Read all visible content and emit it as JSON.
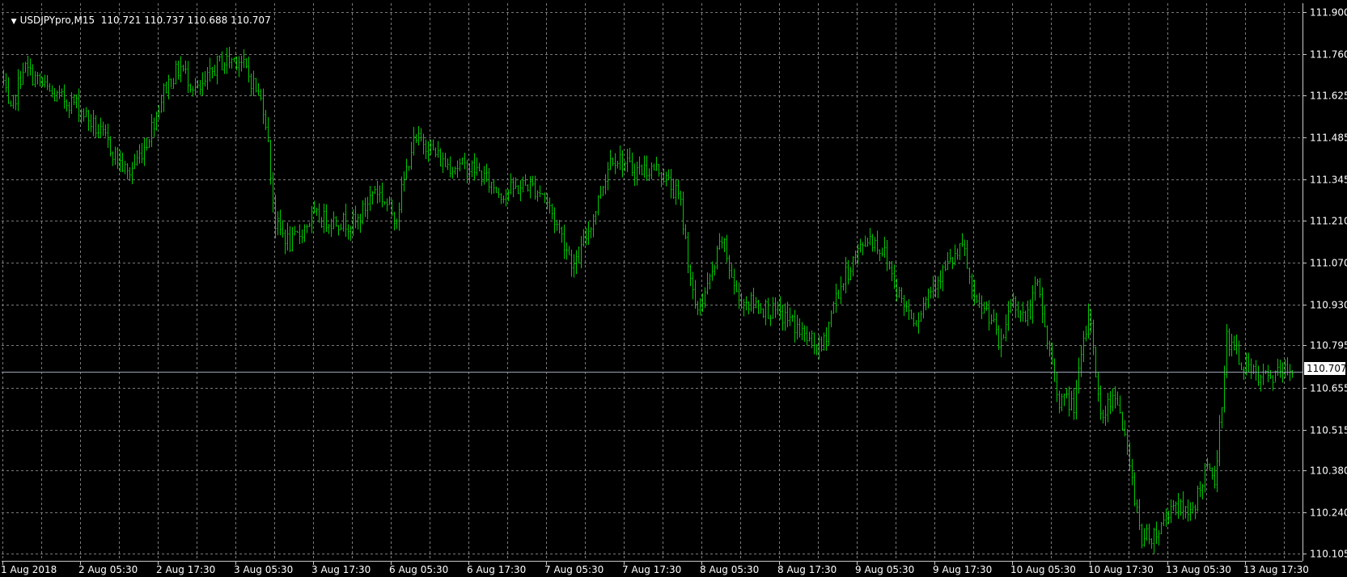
{
  "header": {
    "symbol": "USDJPYpro,M15",
    "ohlc": "110.721 110.737 110.688 110.707"
  },
  "current_price_label": "110.707",
  "chart_data": {
    "type": "bar",
    "title": "USDJPYpro,M15",
    "timeframe": "M15",
    "y_ticks": [
      "111.900",
      "111.760",
      "111.625",
      "111.485",
      "111.345",
      "111.210",
      "111.070",
      "110.930",
      "110.795",
      "110.655",
      "110.515",
      "110.380",
      "110.240",
      "110.105"
    ],
    "x_ticks": [
      "1 Aug 2018",
      "2 Aug 05:30",
      "2 Aug 17:30",
      "3 Aug 05:30",
      "3 Aug 17:30",
      "6 Aug 05:30",
      "6 Aug 17:30",
      "7 Aug 05:30",
      "7 Aug 17:30",
      "8 Aug 05:30",
      "8 Aug 17:30",
      "9 Aug 05:30",
      "9 Aug 17:30",
      "10 Aug 05:30",
      "10 Aug 17:30",
      "13 Aug 05:30",
      "13 Aug 17:30"
    ],
    "ylim": [
      110.08,
      111.93
    ],
    "current_price": 110.707,
    "grid": true,
    "series_color": "#00c800",
    "price_path": [
      {
        "t": 0,
        "p": 111.7
      },
      {
        "t": 3,
        "p": 111.55
      },
      {
        "t": 8,
        "p": 111.72
      },
      {
        "t": 20,
        "p": 111.62
      },
      {
        "t": 28,
        "p": 111.6
      },
      {
        "t": 40,
        "p": 111.47
      },
      {
        "t": 48,
        "p": 111.36
      },
      {
        "t": 55,
        "p": 111.47
      },
      {
        "t": 62,
        "p": 111.65
      },
      {
        "t": 68,
        "p": 111.72
      },
      {
        "t": 75,
        "p": 111.63
      },
      {
        "t": 82,
        "p": 111.73
      },
      {
        "t": 90,
        "p": 111.75
      },
      {
        "t": 96,
        "p": 111.66
      },
      {
        "t": 100,
        "p": 111.58
      },
      {
        "t": 104,
        "p": 111.2
      },
      {
        "t": 110,
        "p": 111.13
      },
      {
        "t": 118,
        "p": 111.22
      },
      {
        "t": 135,
        "p": 111.2
      },
      {
        "t": 142,
        "p": 111.32
      },
      {
        "t": 150,
        "p": 111.22
      },
      {
        "t": 156,
        "p": 111.46
      },
      {
        "t": 160,
        "p": 111.48
      },
      {
        "t": 168,
        "p": 111.4
      },
      {
        "t": 180,
        "p": 111.38
      },
      {
        "t": 190,
        "p": 111.3
      },
      {
        "t": 200,
        "p": 111.33
      },
      {
        "t": 206,
        "p": 111.3
      },
      {
        "t": 213,
        "p": 111.16
      },
      {
        "t": 218,
        "p": 111.05
      },
      {
        "t": 226,
        "p": 111.25
      },
      {
        "t": 232,
        "p": 111.43
      },
      {
        "t": 240,
        "p": 111.38
      },
      {
        "t": 250,
        "p": 111.38
      },
      {
        "t": 258,
        "p": 111.28
      },
      {
        "t": 264,
        "p": 110.9
      },
      {
        "t": 270,
        "p": 111.02
      },
      {
        "t": 274,
        "p": 111.15
      },
      {
        "t": 280,
        "p": 110.95
      },
      {
        "t": 290,
        "p": 110.92
      },
      {
        "t": 300,
        "p": 110.88
      },
      {
        "t": 306,
        "p": 110.82
      },
      {
        "t": 312,
        "p": 110.78
      },
      {
        "t": 317,
        "p": 110.95
      },
      {
        "t": 324,
        "p": 111.08
      },
      {
        "t": 330,
        "p": 111.16
      },
      {
        "t": 336,
        "p": 111.1
      },
      {
        "t": 342,
        "p": 110.95
      },
      {
        "t": 348,
        "p": 110.88
      },
      {
        "t": 354,
        "p": 111.0
      },
      {
        "t": 362,
        "p": 111.08
      },
      {
        "t": 366,
        "p": 111.12
      },
      {
        "t": 370,
        "p": 110.93
      },
      {
        "t": 376,
        "p": 110.9
      },
      {
        "t": 380,
        "p": 110.78
      },
      {
        "t": 384,
        "p": 110.95
      },
      {
        "t": 390,
        "p": 110.88
      },
      {
        "t": 394,
        "p": 111.0
      },
      {
        "t": 398,
        "p": 110.8
      },
      {
        "t": 402,
        "p": 110.62
      },
      {
        "t": 408,
        "p": 110.6
      },
      {
        "t": 414,
        "p": 110.92
      },
      {
        "t": 418,
        "p": 110.55
      },
      {
        "t": 424,
        "p": 110.65
      },
      {
        "t": 428,
        "p": 110.45
      },
      {
        "t": 434,
        "p": 110.15
      },
      {
        "t": 440,
        "p": 110.18
      },
      {
        "t": 446,
        "p": 110.28
      },
      {
        "t": 452,
        "p": 110.22
      },
      {
        "t": 458,
        "p": 110.38
      },
      {
        "t": 462,
        "p": 110.35
      },
      {
        "t": 466,
        "p": 110.82
      },
      {
        "t": 472,
        "p": 110.74
      },
      {
        "t": 478,
        "p": 110.68
      },
      {
        "t": 486,
        "p": 110.7
      },
      {
        "t": 492,
        "p": 110.72
      }
    ]
  }
}
